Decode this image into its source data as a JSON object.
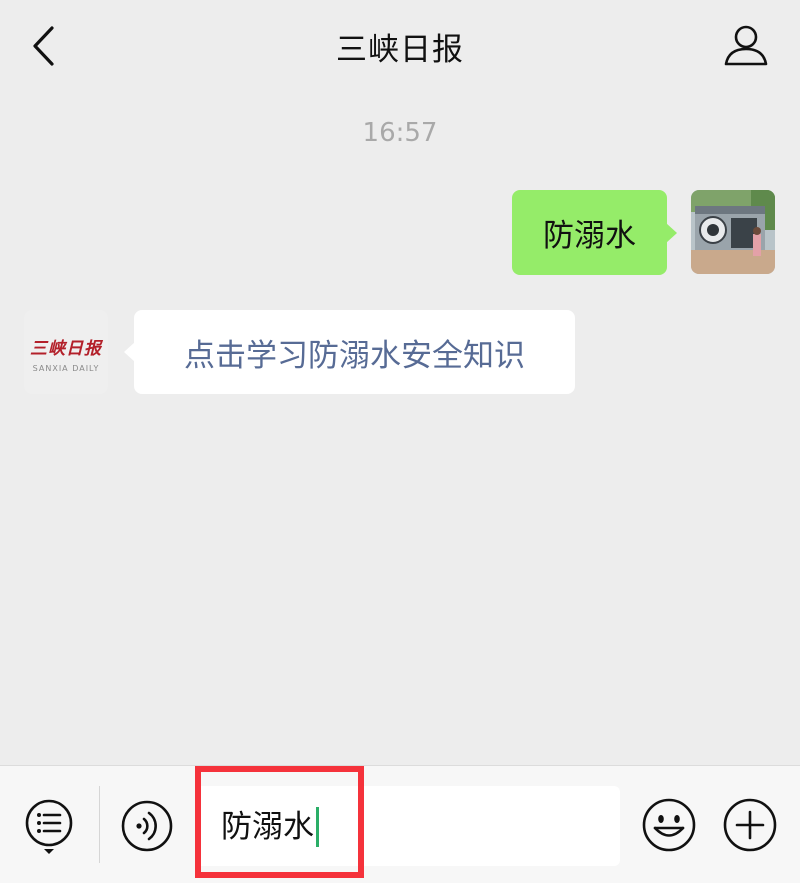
{
  "header": {
    "title": "三峡日报",
    "back_icon": "chevron-left-icon",
    "profile_icon": "person-icon"
  },
  "chat": {
    "timestamp": "16:57",
    "outgoing": {
      "text": "防溺水"
    },
    "incoming": {
      "text": "点击学习防溺水安全知识",
      "avatar_logo": "三峡日报",
      "avatar_subtext": "SANXIA DAILY"
    }
  },
  "input_bar": {
    "menu_icon": "menu-list-icon",
    "voice_icon": "voice-icon",
    "value": "防溺水",
    "emoji_icon": "emoji-icon",
    "plus_icon": "plus-icon"
  },
  "colors": {
    "background": "#ededed",
    "outgoing_bubble": "#95ec69",
    "link_text": "#576b95",
    "highlight": "#f5323b",
    "caret": "#2aae67"
  }
}
